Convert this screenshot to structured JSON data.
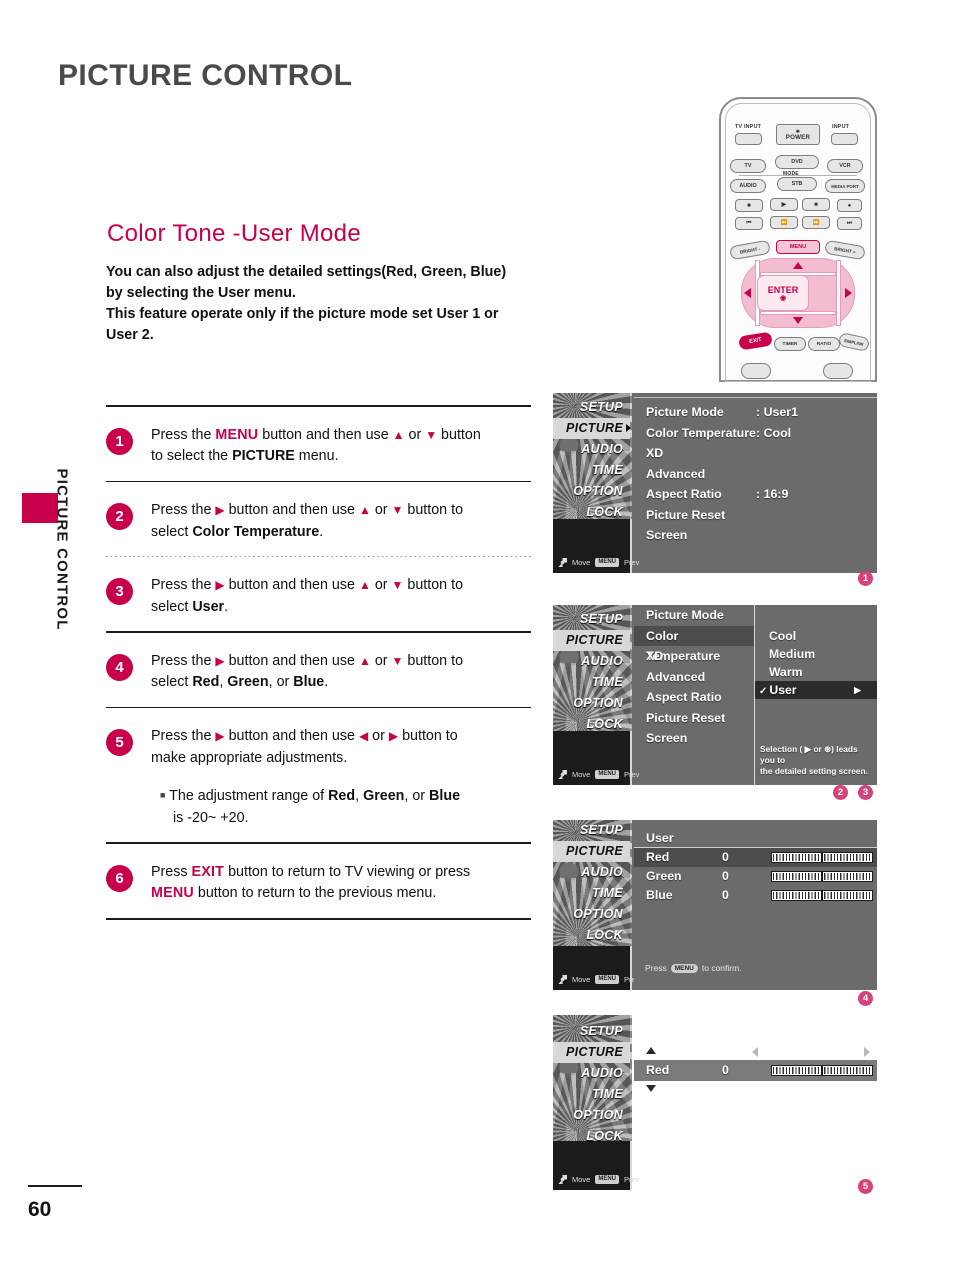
{
  "header": {
    "title": "PICTURE CONTROL"
  },
  "side_tab": {
    "label": "PICTURE CONTROL",
    "color": "#c8004b"
  },
  "footer": {
    "page_number": "60"
  },
  "section": {
    "heading": "Color Tone -User Mode",
    "intro_line1": "You can also adjust the detailed settings(Red, Green, Blue)",
    "intro_line2_prefix": "by selecting the ",
    "intro_line2_bold": "User",
    "intro_line2_suffix": " menu.",
    "intro_line3_prefix": "This feature operate only if the picture mode set ",
    "intro_line3_bold1": "User 1",
    "intro_line3_mid": " or",
    "intro_line4_bold": "User 2",
    "intro_line4_suffix": "."
  },
  "steps": [
    {
      "number": "1",
      "p1": "Press the ",
      "key1": "MENU",
      "p2": " button and then use ",
      "arrow_up": "▲",
      "p3": " or ",
      "arrow_down": "▼",
      "p4": " button",
      "p5": "to select the ",
      "bold1": "PICTURE",
      "p6": " menu."
    },
    {
      "number": "2",
      "p1": "Press the ",
      "arrow_right": "▶",
      "p2": " button and then use ",
      "arrow_up": "▲",
      "p3": " or ",
      "arrow_down": "▼",
      "p4": " button to",
      "p5": "select ",
      "bold1": "Color Temperature",
      "p6": "."
    },
    {
      "number": "3",
      "p1": "Press the ",
      "arrow_right": "▶",
      "p2": " button and then use ",
      "arrow_up": "▲",
      "p3": " or ",
      "arrow_down": "▼",
      "p4": " button to",
      "p5": "select ",
      "bold1": "User",
      "p6": "."
    },
    {
      "number": "4",
      "p1": "Press the ",
      "arrow_right": "▶",
      "p2": " button and then use ",
      "arrow_up": "▲",
      "p3": " or ",
      "arrow_down": "▼",
      "p4": " button to",
      "p5": "select ",
      "bold1": "Red",
      "p5b": ", ",
      "bold2": "Green",
      "p5c": ", or ",
      "bold3": "Blue",
      "p6": "."
    },
    {
      "number": "5",
      "p1": "Press the ",
      "arrow_right": "▶",
      "p2": " button and then use ",
      "arrow_left": "◀",
      "p3": " or ",
      "arrow_right2": "▶",
      "p4": " button to",
      "p5": "make appropriate adjustments.",
      "note_prefix": "The adjustment range of ",
      "note_bold1": "Red",
      "note_mid1": ", ",
      "note_bold2": "Green",
      "note_mid2": ", or ",
      "note_bold3": "Blue",
      "note_line2": "is -20~ +20."
    },
    {
      "number": "6",
      "p1": "Press ",
      "key1": "EXIT",
      "p2": " button to return to TV viewing or press",
      "key2": "MENU",
      "p3": " button to return to the previous menu."
    }
  ],
  "osd": {
    "sidebar_items": [
      "SETUP",
      "PICTURE",
      "AUDIO",
      "TIME",
      "OPTION",
      "LOCK"
    ],
    "sidebar_selected": "PICTURE",
    "footer_move": "Move",
    "footer_prev_chip": "MENU",
    "footer_prev": "Prev",
    "screen1": {
      "rows": [
        {
          "label": "Picture Mode",
          "value": ": User1"
        },
        {
          "label": "Color Temperature",
          "value": ": Cool"
        },
        {
          "label": "XD",
          "value": ""
        },
        {
          "label": "Advanced",
          "value": ""
        },
        {
          "label": "Aspect Ratio",
          "value": ": 16:9"
        },
        {
          "label": "Picture Reset",
          "value": ""
        },
        {
          "label": "Screen",
          "value": ""
        }
      ],
      "marker": "1"
    },
    "screen2": {
      "rows": [
        {
          "label": "Picture Mode",
          "highlight": false
        },
        {
          "label": "Color Temperature",
          "highlight": true
        },
        {
          "label": "XD",
          "highlight": false
        },
        {
          "label": "Advanced",
          "highlight": false
        },
        {
          "label": "Aspect Ratio",
          "highlight": false
        },
        {
          "label": "Picture Reset",
          "highlight": false
        },
        {
          "label": "Screen",
          "highlight": false
        }
      ],
      "options": [
        {
          "label": "Cool",
          "selected": false
        },
        {
          "label": "Medium",
          "selected": false
        },
        {
          "label": "Warm",
          "selected": false
        },
        {
          "label": "User",
          "selected": true
        }
      ],
      "check_glyph": "✓",
      "arrow_glyph": "▶",
      "hint_line1": "Selection ( ▶ or ⊛) leads you  to",
      "hint_line2": "the detailed setting screen.",
      "markers": [
        "2",
        "3"
      ]
    },
    "screen3": {
      "title": "User",
      "rows": [
        {
          "label": "Red",
          "value": "0",
          "highlight": true
        },
        {
          "label": "Green",
          "value": "0",
          "highlight": false
        },
        {
          "label": "Blue",
          "value": "0",
          "highlight": false
        }
      ],
      "confirm_prefix": "Press",
      "confirm_chip": "MENU",
      "confirm_suffix": "to confirm.",
      "marker": "4"
    },
    "screen4": {
      "label": "Red",
      "value": "0",
      "marker": "5"
    }
  },
  "remote": {
    "tv_input": "TV INPUT",
    "power": "POWER",
    "input": "INPUT",
    "mode_label": "MODE",
    "src_tv": "TV",
    "src_dvd": "DVD",
    "src_vcr": "VCR",
    "src_audio": "AUDIO",
    "src_stb": "STB",
    "src_media": "MEDIA PORT",
    "bright_minus": "BRIGHT -",
    "menu": "MENU",
    "bright_plus": "BRIGHT +",
    "enter": "ENTER",
    "exit": "EXIT",
    "timer": "TIMER",
    "ratio": "RATIO",
    "simplink": "SIMPLINK"
  }
}
